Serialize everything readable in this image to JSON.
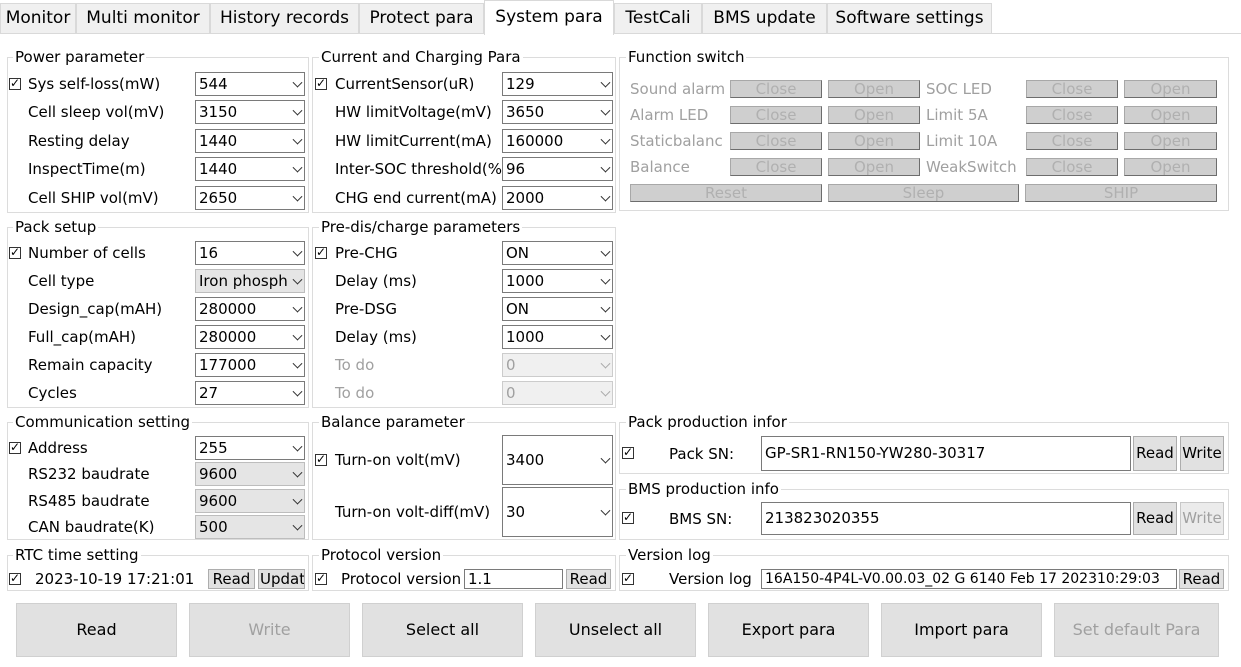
{
  "tabs": [
    "Monitor",
    "Multi monitor",
    "History records",
    "Protect para",
    "System para",
    "TestCali",
    "BMS update",
    "Software settings"
  ],
  "active_tab": "System para",
  "power": {
    "title": "Power parameter",
    "rows": [
      {
        "label": "Sys self-loss(mW)",
        "value": "544"
      },
      {
        "label": "Cell sleep vol(mV)",
        "value": "3150"
      },
      {
        "label": "Resting delay",
        "value": "1440"
      },
      {
        "label": "InspectTime(m)",
        "value": "1440"
      },
      {
        "label": "Cell SHIP vol(mV)",
        "value": "2650"
      }
    ]
  },
  "current": {
    "title": "Current and Charging Para",
    "rows": [
      {
        "label": "CurrentSensor(uR)",
        "value": "129"
      },
      {
        "label": "HW limitVoltage(mV)",
        "value": "3650"
      },
      {
        "label": "HW limitCurrent(mA)",
        "value": "160000"
      },
      {
        "label": "Inter-SOC threshold(%)",
        "value": "96"
      },
      {
        "label": "CHG end current(mA)",
        "value": "2000"
      }
    ]
  },
  "function_switch": {
    "title": "Function switch",
    "rows": [
      {
        "left": "Sound alarm",
        "right": "SOC LED"
      },
      {
        "left": "Alarm LED",
        "right": "Limit 5A"
      },
      {
        "left": "Staticbalanc",
        "right": "Limit 10A"
      },
      {
        "left": "Balance",
        "right": "WeakSwitch"
      }
    ],
    "close_label": "Close",
    "open_label": "Open",
    "bottom": [
      "Reset",
      "Sleep",
      "SHIP"
    ]
  },
  "pack": {
    "title": "Pack setup",
    "rows": [
      {
        "label": "Number of cells",
        "value": "16"
      },
      {
        "label": "Cell type",
        "value": "Iron phosph"
      },
      {
        "label": "Design_cap(mAH)",
        "value": "280000"
      },
      {
        "label": "Full_cap(mAH)",
        "value": "280000"
      },
      {
        "label": "Remain capacity",
        "value": "177000"
      },
      {
        "label": "Cycles",
        "value": "27"
      }
    ]
  },
  "predis": {
    "title": "Pre-dis/charge parameters",
    "rows": [
      {
        "label": "Pre-CHG",
        "value": "ON"
      },
      {
        "label": "Delay (ms)",
        "value": "1000"
      },
      {
        "label": "Pre-DSG",
        "value": "ON"
      },
      {
        "label": "Delay (ms)",
        "value": "1000"
      },
      {
        "label": "To do",
        "value": "0"
      },
      {
        "label": "To do",
        "value": "0"
      }
    ]
  },
  "comm": {
    "title": "Communication setting",
    "rows": [
      {
        "label": "Address",
        "value": "255"
      },
      {
        "label": "RS232 baudrate",
        "value": "9600"
      },
      {
        "label": "RS485 baudrate",
        "value": "9600"
      },
      {
        "label": "CAN baudrate(K)",
        "value": "500"
      }
    ]
  },
  "balance": {
    "title": "Balance parameter",
    "rows": [
      {
        "label": "Turn-on volt(mV)",
        "value": "3400"
      },
      {
        "label": "Turn-on volt-diff(mV)",
        "value": "30"
      }
    ]
  },
  "pack_prod": {
    "title": "Pack production infor",
    "label": "Pack SN:",
    "value": "GP-SR1-RN150-YW280-30317",
    "read": "Read",
    "write": "Write"
  },
  "bms_prod": {
    "title": "BMS production info",
    "label": "BMS SN:",
    "value": "213823020355",
    "read": "Read",
    "write": "Write"
  },
  "rtc": {
    "title": "RTC time setting",
    "value": "2023-10-19 17:21:01",
    "read": "Read",
    "update": "Update"
  },
  "protocol": {
    "title": "Protocol version",
    "label": "Protocol version",
    "value": "1.1",
    "read": "Read"
  },
  "version": {
    "title": "Version log",
    "label": "Version log",
    "value": "16A150-4P4L-V0.00.03_02 G 6140 Feb 17 202310:29:03",
    "read": "Read"
  },
  "bottom_buttons": [
    "Read",
    "Write",
    "Select all",
    "Unselect all",
    "Export para",
    "Import para",
    "Set default Para"
  ]
}
